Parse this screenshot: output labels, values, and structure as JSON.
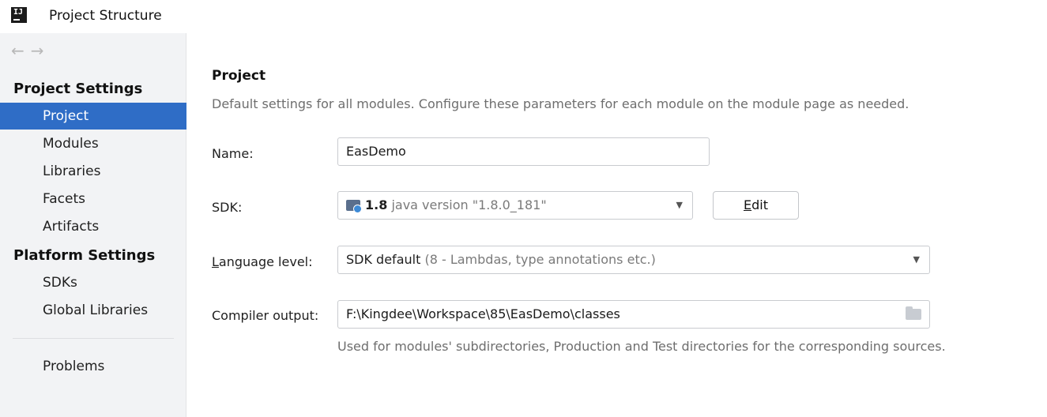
{
  "window": {
    "title": "Project Structure",
    "logo_text": "IJ"
  },
  "nav": {
    "back": "←",
    "forward": "→"
  },
  "sidebar": {
    "project_settings_title": "Project Settings",
    "project_settings_items": [
      {
        "label": "Project",
        "selected": true
      },
      {
        "label": "Modules",
        "selected": false
      },
      {
        "label": "Libraries",
        "selected": false
      },
      {
        "label": "Facets",
        "selected": false
      },
      {
        "label": "Artifacts",
        "selected": false
      }
    ],
    "platform_settings_title": "Platform Settings",
    "platform_settings_items": [
      {
        "label": "SDKs"
      },
      {
        "label": "Global Libraries"
      }
    ],
    "problems_label": "Problems"
  },
  "main": {
    "title": "Project",
    "description": "Default settings for all modules. Configure these parameters for each module on the module page as needed.",
    "name": {
      "label": "Name:",
      "value": "EasDemo"
    },
    "sdk": {
      "label": "SDK:",
      "version": "1.8",
      "detail": "java version \"1.8.0_181\"",
      "edit_button_mnemonic": "E",
      "edit_button_rest": "dit"
    },
    "language_level": {
      "label_mnemonic": "L",
      "label_rest": "anguage level:",
      "value": "SDK default",
      "detail": "(8 - Lambdas, type annotations etc.)"
    },
    "compiler_output": {
      "label": "Compiler output:",
      "value": "F:\\Kingdee\\Workspace\\85\\EasDemo\\classes",
      "hint": "Used for modules' subdirectories, Production and Test directories for the corresponding sources."
    }
  },
  "colors": {
    "selection": "#2f6dc6",
    "sidebar_bg": "#f2f3f5"
  }
}
